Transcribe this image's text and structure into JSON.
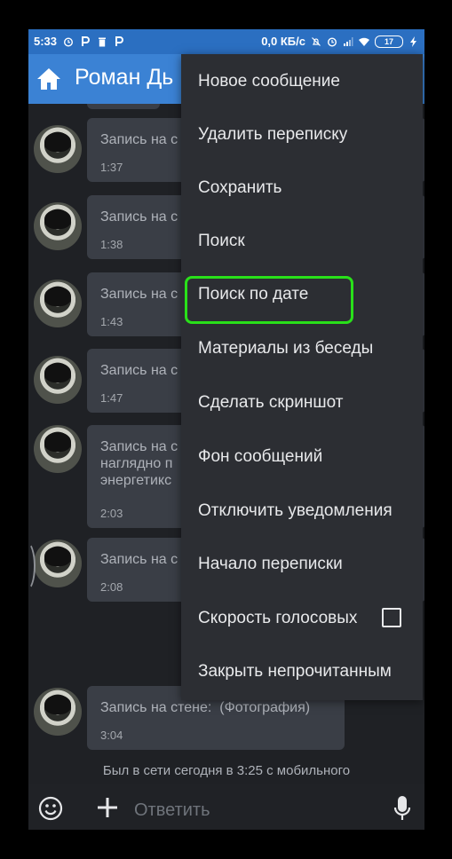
{
  "status_bar": {
    "time": "5:33",
    "left_icons": [
      "alarm-icon",
      "p-app-icon",
      "trash-icon",
      "p-app-icon"
    ],
    "speed": "0,0 КБ/с",
    "right_icons": [
      "mute-icon",
      "alarm-icon",
      "signal-icon",
      "wifi-icon"
    ],
    "battery": "17",
    "color": "#2b6fc1"
  },
  "app_bar": {
    "title": "Роман Дь",
    "color": "#3b82d4"
  },
  "messages": [
    {
      "text": "Запись на с",
      "time": "1:37"
    },
    {
      "text": "Запись на с",
      "time": "1:38"
    },
    {
      "text": "Запись на с",
      "time": "1:43"
    },
    {
      "text": "Запись на с",
      "time": "1:47"
    },
    {
      "text": "Запись на с\nнаглядно п\nэнергетикс",
      "time": "2:03"
    },
    {
      "text": "Запись на с",
      "time": "2:08"
    },
    {
      "text": "Запись на стене:  (Фотография)",
      "time": "3:04"
    }
  ],
  "online_status": "Был в сети сегодня в 3:25 с мобильного",
  "composer": {
    "placeholder": "Ответить"
  },
  "menu": {
    "items": [
      {
        "label": "Новое сообщение"
      },
      {
        "label": "Удалить переписку"
      },
      {
        "label": "Сохранить"
      },
      {
        "label": "Поиск"
      },
      {
        "label": "Поиск по дате"
      },
      {
        "label": "Материалы из беседы"
      },
      {
        "label": "Сделать скриншот"
      },
      {
        "label": "Фон сообщений"
      },
      {
        "label": "Отключить уведомления"
      },
      {
        "label": "Начало переписки"
      },
      {
        "label": "Скорость голосовых",
        "checkbox": true,
        "checked": false
      },
      {
        "label": "Закрыть непрочитанным"
      }
    ],
    "highlighted_item": "Поиск по дате",
    "highlight_color": "#29e01a"
  }
}
